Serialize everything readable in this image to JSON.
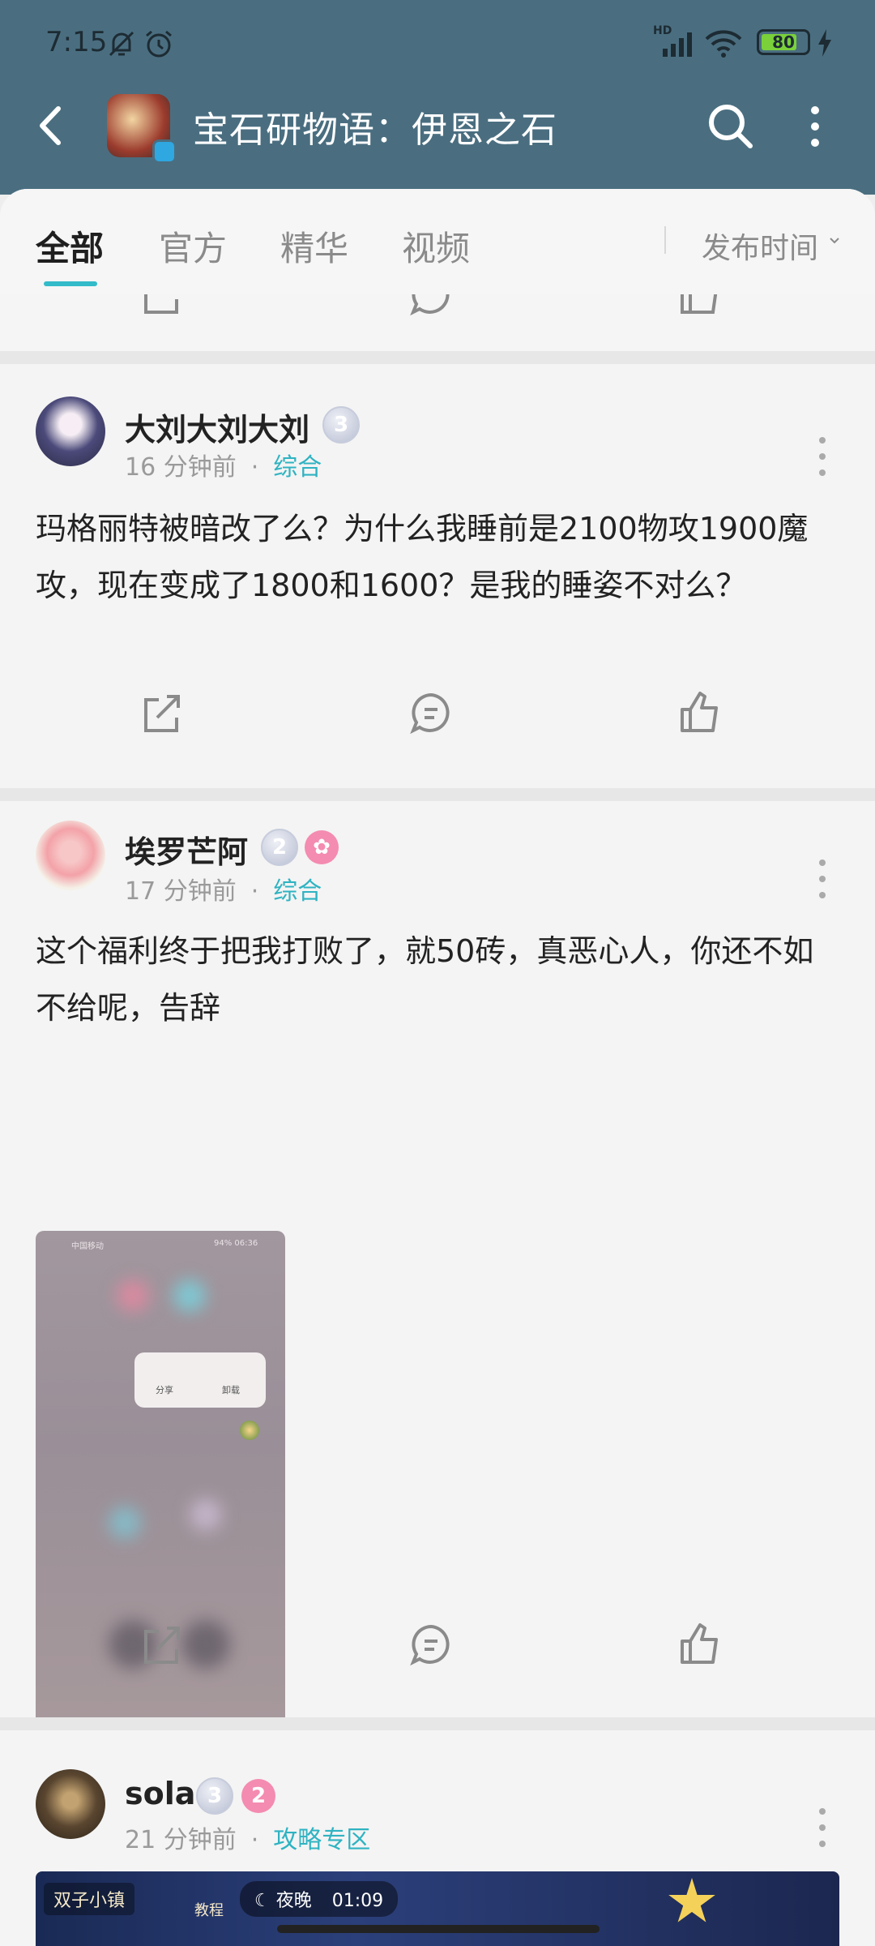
{
  "status_bar": {
    "time": "7:15",
    "battery": "80",
    "battery_level": 0.8,
    "network": "HD"
  },
  "header": {
    "title": "宝石研物语：伊恩之石"
  },
  "tabs": [
    {
      "label": "全部",
      "active": true
    },
    {
      "label": "官方",
      "active": false
    },
    {
      "label": "精华",
      "active": false
    },
    {
      "label": "视频",
      "active": false
    }
  ],
  "sort": {
    "label": "发布时间"
  },
  "posts": [
    {
      "username": "大刘大刘大刘",
      "level": "3",
      "time": "16 分钟前",
      "category": "综合",
      "content": "玛格丽特被暗改了么？为什么我睡前是2100物攻1900魔攻，现在变成了1800和1600？是我的睡姿不对么？"
    },
    {
      "username": "埃罗芒阿",
      "level": "2",
      "time": "17 分钟前",
      "category": "综合",
      "content": "这个福利终于把我打败了，就50砖，真恶心人，你还不如不给呢，告辞",
      "image": {
        "status_left": "中国移动",
        "status_right": "94% 06:36",
        "popup_share": "分享",
        "popup_uninstall": "卸载"
      }
    },
    {
      "username": "sola",
      "level": "3",
      "badge": "2",
      "time": "21 分钟前",
      "category": "攻略专区",
      "banner": {
        "tag": "双子小镇",
        "level_label": "教程",
        "night_label": "夜晚",
        "night_time": "01:09"
      }
    }
  ],
  "colors": {
    "header_bg": "#4a6e80",
    "accent": "#33bbc9",
    "category": "#2fb3c2"
  }
}
